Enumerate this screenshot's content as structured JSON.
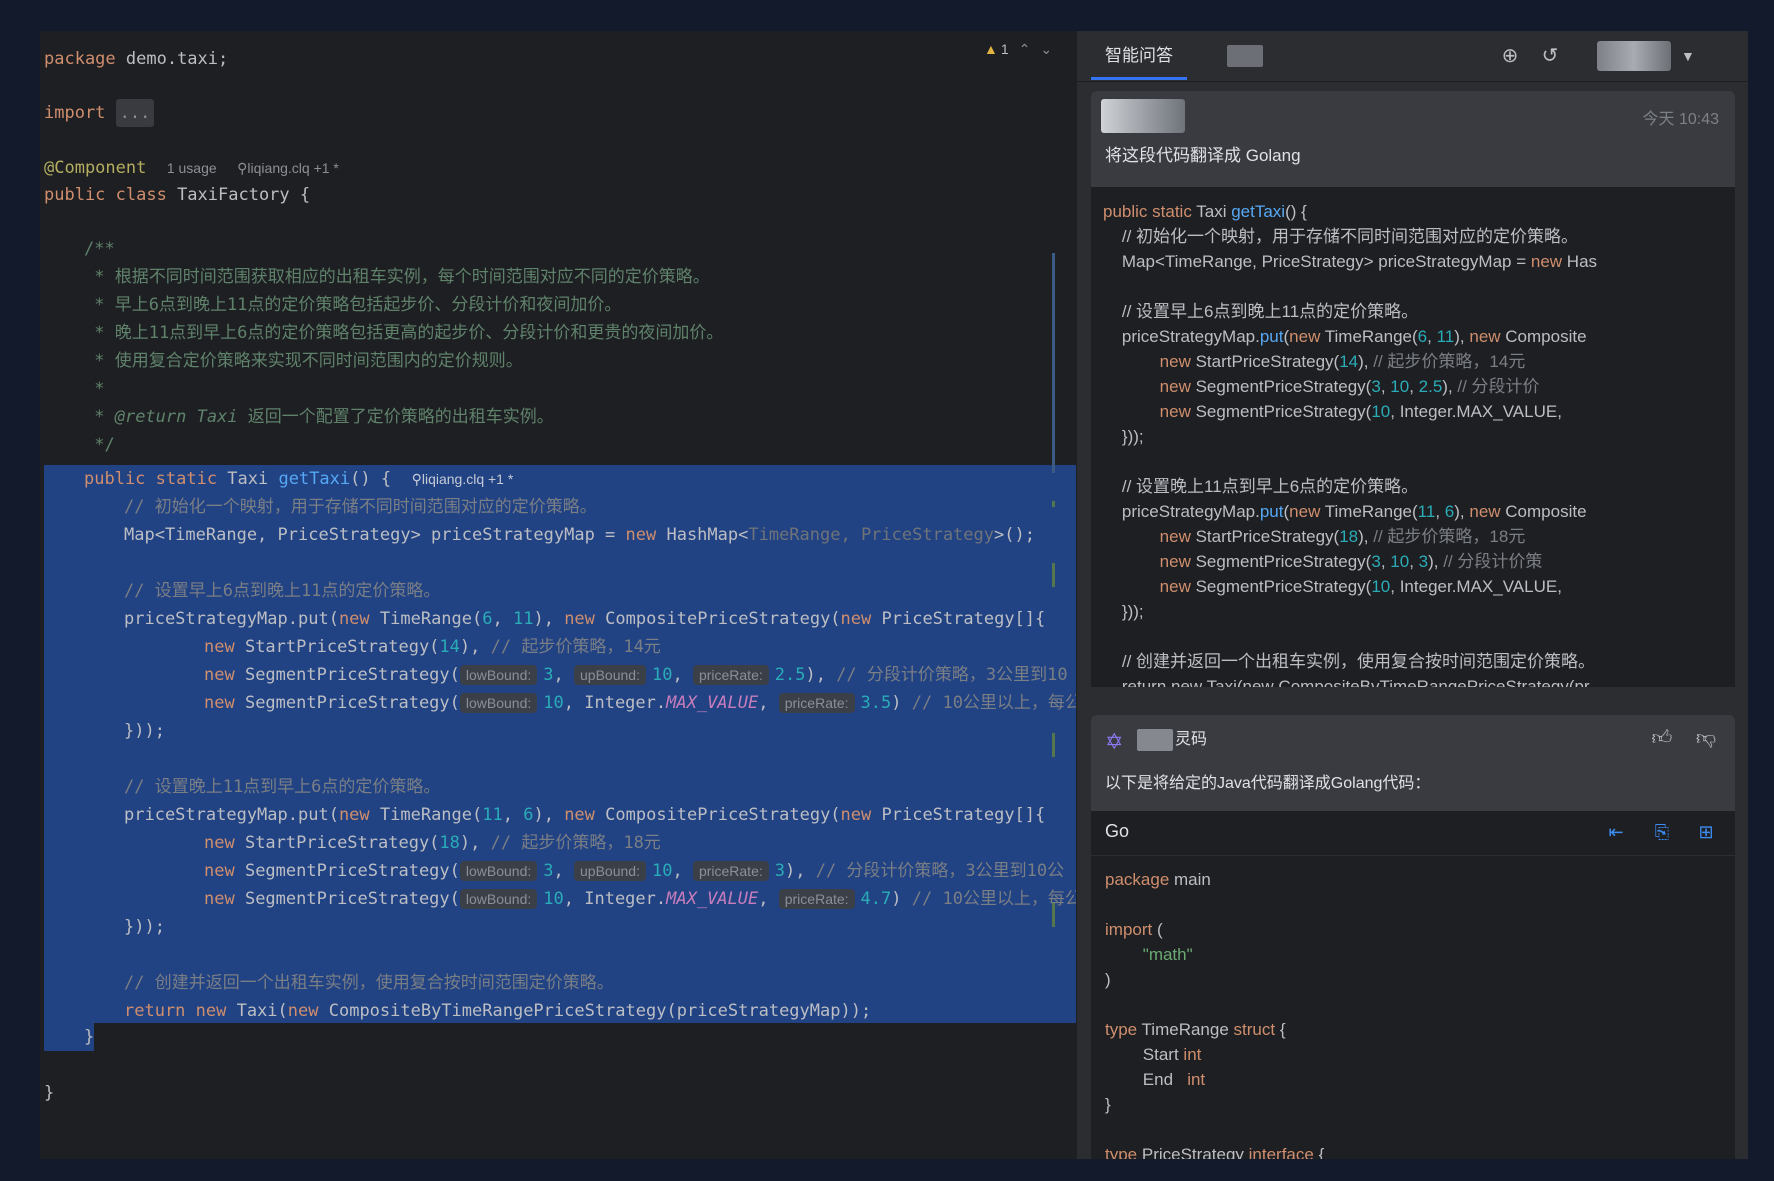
{
  "editor": {
    "warning_count": "1",
    "lines": {
      "package": [
        "package",
        " demo.taxi;"
      ],
      "import": [
        "import",
        "..."
      ],
      "component": [
        "@Component",
        "1 usage",
        "liqiang.clq +1 *"
      ],
      "class_decl": [
        "public class",
        " TaxiFactory {"
      ],
      "doc_open": "/**",
      "doc1": " * 根据不同时间范围获取相应的出租车实例，每个时间范围对应不同的定价策略。",
      "doc2": " * 早上6点到晚上11点的定价策略包括起步价、分段计价和夜间加价。",
      "doc3": " * 晚上11点到早上6点的定价策略包括更高的起步价、分段计价和更贵的夜间加价。",
      "doc4": " * 使用复合定价策略来实现不同时间范围内的定价规则。",
      "doc5": " *",
      "doc6": [
        " * ",
        "@return",
        " Taxi ",
        "返回一个配置了定价策略的出租车实例。"
      ],
      "doc_close": " */",
      "method": [
        "public static",
        " Taxi ",
        "getTaxi",
        "() {",
        "liqiang.clq +1 *"
      ],
      "c1": "// 初始化一个映射，用于存储不同时间范围对应的定价策略。",
      "map_decl": [
        "Map<TimeRange, PriceStrategy> priceStrategyMap = ",
        "new",
        " HashMap<",
        "TimeRange, PriceStrategy",
        ">();"
      ],
      "c2": "// 设置早上6点到晚上11点的定价策略。",
      "put1": [
        "priceStrategyMap.put(",
        "new",
        " TimeRange(",
        "6",
        ", ",
        "11",
        "), ",
        "new",
        " CompositePriceStrategy(",
        "new",
        " PriceStrategy[]{"
      ],
      "start1": [
        "new",
        " StartPriceStrategy(",
        "14",
        "), ",
        "// 起步价策略，14元"
      ],
      "seg1a": [
        "new",
        " SegmentPriceStrategy(",
        "lowBound:",
        "3",
        ", ",
        "upBound:",
        "10",
        ", ",
        "priceRate:",
        "2.5",
        "), ",
        "// 分段计价策略，3公里到10"
      ],
      "seg1b": [
        "new",
        " SegmentPriceStrategy(",
        "lowBound:",
        "10",
        ", Integer.",
        "MAX_VALUE",
        ", ",
        "priceRate:",
        "3.5",
        ") ",
        "// 10公里以上，每公"
      ],
      "close1": "}));",
      "c3": "// 设置晚上11点到早上6点的定价策略。",
      "put2": [
        "priceStrategyMap.put(",
        "new",
        " TimeRange(",
        "11",
        ", ",
        "6",
        "), ",
        "new",
        " CompositePriceStrategy(",
        "new",
        " PriceStrategy[]{"
      ],
      "start2": [
        "new",
        " StartPriceStrategy(",
        "18",
        "), ",
        "// 起步价策略，18元"
      ],
      "seg2a": [
        "new",
        " SegmentPriceStrategy(",
        "lowBound:",
        "3",
        ", ",
        "upBound:",
        "10",
        ", ",
        "priceRate:",
        "3",
        "), ",
        "// 分段计价策略，3公里到10公"
      ],
      "seg2b": [
        "new",
        " SegmentPriceStrategy(",
        "lowBound:",
        "10",
        ", Integer.",
        "MAX_VALUE",
        ", ",
        "priceRate:",
        "4.7",
        ") ",
        "// 10公里以上，每公"
      ],
      "close2": "}));",
      "c4": "// 创建并返回一个出租车实例，使用复合按时间范围定价策略。",
      "ret": [
        "return new",
        " Taxi(",
        "new",
        " CompositeByTimeRangePriceStrategy(priceStrategyMap));"
      ],
      "method_close": "}",
      "class_close": "}"
    }
  },
  "panel": {
    "tab_active": "智能问答",
    "question": {
      "time": "今天 10:43",
      "text": "将这段代码翻译成 Golang"
    },
    "qcode": {
      "l1": [
        "public static",
        " Taxi ",
        "getTaxi",
        "() {"
      ],
      "l2": "    // 初始化一个映射，用于存储不同时间范围对应的定价策略。",
      "l3": [
        "    Map<TimeRange, PriceStrategy> priceStrategyMap = ",
        "new",
        " Has"
      ],
      "l4": "    // 设置早上6点到晚上11点的定价策略。",
      "l5": [
        "    priceStrategyMap.",
        "put",
        "(",
        "new",
        " TimeRange(",
        "6",
        ", ",
        "11",
        "), ",
        "new",
        " Composite"
      ],
      "l6": [
        "            new",
        " StartPriceStrategy(",
        "14",
        "), ",
        "// 起步价策略，14元"
      ],
      "l7": [
        "            new",
        " SegmentPriceStrategy(",
        "3",
        ", ",
        "10",
        ", ",
        "2.5",
        "), ",
        "// 分段计价"
      ],
      "l8": [
        "            new",
        " SegmentPriceStrategy(",
        "10",
        ", Integer.MAX_VALUE,"
      ],
      "l9": "    }));",
      "l10": "    // 设置晚上11点到早上6点的定价策略。",
      "l11": [
        "    priceStrategyMap.",
        "put",
        "(",
        "new",
        " TimeRange(",
        "11",
        ", ",
        "6",
        "), ",
        "new",
        " Composite"
      ],
      "l12": [
        "            new",
        " StartPriceStrategy(",
        "18",
        "), ",
        "// 起步价策略，18元"
      ],
      "l13": [
        "            new",
        " SegmentPriceStrategy(",
        "3",
        ", ",
        "10",
        ", ",
        "3",
        "), ",
        "// 分段计价策"
      ],
      "l14": [
        "            new",
        " SegmentPriceStrategy(",
        "10",
        ", Integer.MAX_VALUE,"
      ],
      "l15": "    }));",
      "l16": "    // 创建并返回一个出租车实例，使用复合按时间范围定价策略。",
      "l17": "    return new Taxi(new CompositeByTimeRangePriceStrategy(pr"
    },
    "answer": {
      "name": "灵码",
      "text": "以下是将给定的Java代码翻译成Golang代码："
    },
    "gocode": {
      "lang": "Go",
      "l1": [
        "package",
        " main"
      ],
      "l2": [
        "import",
        " ("
      ],
      "l3": "        \"math\"",
      "l4": ")",
      "l5": [
        "type",
        " TimeRange ",
        "struct",
        " {"
      ],
      "l6": [
        "        Start ",
        "int"
      ],
      "l7": [
        "        End   ",
        "int"
      ],
      "l8": "}",
      "l9": [
        "type",
        " PriceStrategy ",
        "interface",
        " {"
      ]
    }
  }
}
